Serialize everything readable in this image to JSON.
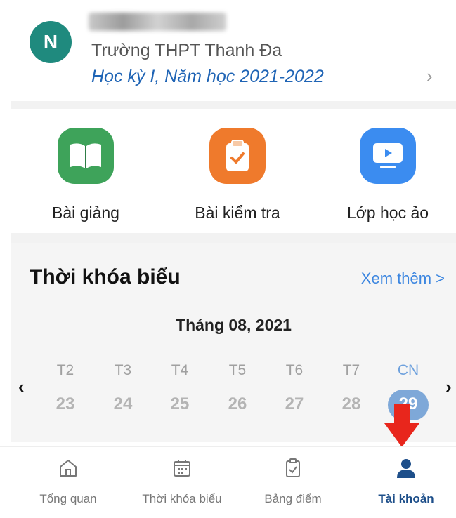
{
  "profile": {
    "avatar_letter": "N",
    "school": "Trường THPT Thanh Đa",
    "term": "Học kỳ I, Năm học 2021-2022"
  },
  "features": [
    {
      "label": "Bài giảng",
      "icon": "book-icon",
      "color": "#3ea35a"
    },
    {
      "label": "Bài kiểm tra",
      "icon": "clipboard-check-icon",
      "color": "#ef7a2c"
    },
    {
      "label": "Lớp học ảo",
      "icon": "video-screen-icon",
      "color": "#3b8cf0"
    }
  ],
  "timetable": {
    "title": "Thời khóa biểu",
    "see_more": "Xem thêm >",
    "month": "Tháng 08, 2021",
    "days": [
      {
        "name": "T2",
        "num": "23"
      },
      {
        "name": "T3",
        "num": "24"
      },
      {
        "name": "T4",
        "num": "25"
      },
      {
        "name": "T5",
        "num": "26"
      },
      {
        "name": "T6",
        "num": "27"
      },
      {
        "name": "T7",
        "num": "28"
      },
      {
        "name": "CN",
        "num": "29",
        "selected": true
      }
    ],
    "prev": "‹",
    "next": "›"
  },
  "bottom_nav": [
    {
      "label": "Tổng quan",
      "icon": "home-icon"
    },
    {
      "label": "Thời khóa biểu",
      "icon": "calendar-icon"
    },
    {
      "label": "Bảng điểm",
      "icon": "clipboard-icon"
    },
    {
      "label": "Tài khoản",
      "icon": "user-icon",
      "active": true
    }
  ],
  "colors": {
    "accent_blue": "#1f64b5",
    "annotation_red": "#e8261c"
  }
}
